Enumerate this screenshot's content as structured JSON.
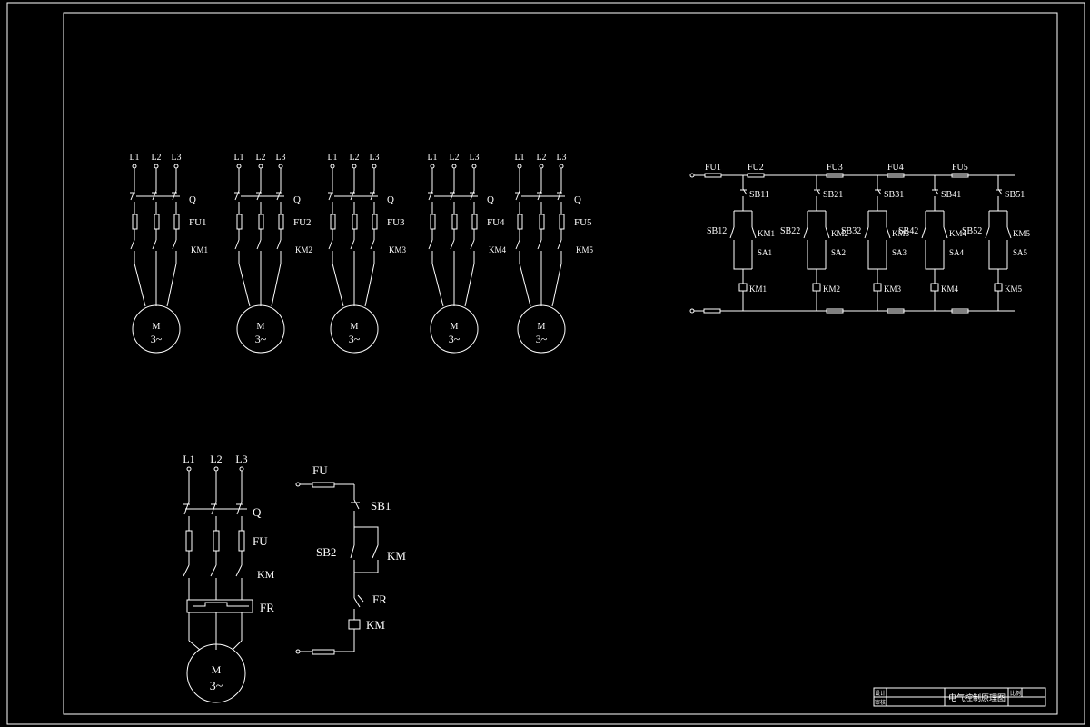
{
  "motor_circuits": [
    {
      "lines": [
        "L1",
        "L2",
        "L3"
      ],
      "switch": "Q",
      "fuse": "FU1",
      "contactor": "KM1",
      "motor": [
        "M",
        "3~"
      ]
    },
    {
      "lines": [
        "L1",
        "L2",
        "L3"
      ],
      "switch": "Q",
      "fuse": "FU2",
      "contactor": "KM2",
      "motor": [
        "M",
        "3~"
      ]
    },
    {
      "lines": [
        "L1",
        "L2",
        "L3"
      ],
      "switch": "Q",
      "fuse": "FU3",
      "contactor": "KM3",
      "motor": [
        "M",
        "3~"
      ]
    },
    {
      "lines": [
        "L1",
        "L2",
        "L3"
      ],
      "switch": "Q",
      "fuse": "FU4",
      "contactor": "KM4",
      "motor": [
        "M",
        "3~"
      ]
    },
    {
      "lines": [
        "L1",
        "L2",
        "L3"
      ],
      "switch": "Q",
      "fuse": "FU5",
      "contactor": "KM5",
      "motor": [
        "M",
        "3~"
      ]
    }
  ],
  "control_circuit": {
    "fuses": [
      "FU1",
      "FU2",
      "FU3",
      "FU4",
      "FU5"
    ],
    "branches": [
      {
        "stop": "SB11",
        "start": "SB12",
        "hold": "KM1",
        "selector": "SA1",
        "coil": "KM1"
      },
      {
        "stop": "SB21",
        "start": "SB22",
        "hold": "KM2",
        "selector": "SA2",
        "coil": "KM2"
      },
      {
        "stop": "SB31",
        "start": "SB32",
        "hold": "KM3",
        "selector": "SA3",
        "coil": "KM3"
      },
      {
        "stop": "SB41",
        "start": "SB42",
        "hold": "KM4",
        "selector": "SA4",
        "coil": "KM4"
      },
      {
        "stop": "SB51",
        "start": "SB52",
        "hold": "KM5",
        "selector": "SA5",
        "coil": "KM5"
      }
    ]
  },
  "main_circuit": {
    "lines": [
      "L1",
      "L2",
      "L3"
    ],
    "switch": "Q",
    "fuse": "FU",
    "contactor": "KM",
    "relay": "FR",
    "motor": [
      "M",
      "3~"
    ]
  },
  "single_control": {
    "fuse": "FU",
    "stop": "SB1",
    "start": "SB2",
    "hold": "KM",
    "relay": "FR",
    "coil": "KM"
  },
  "title_block": {
    "title": "电气控制原理图",
    "row_labels": [
      "设计",
      "审核"
    ],
    "field_label": "比例"
  }
}
